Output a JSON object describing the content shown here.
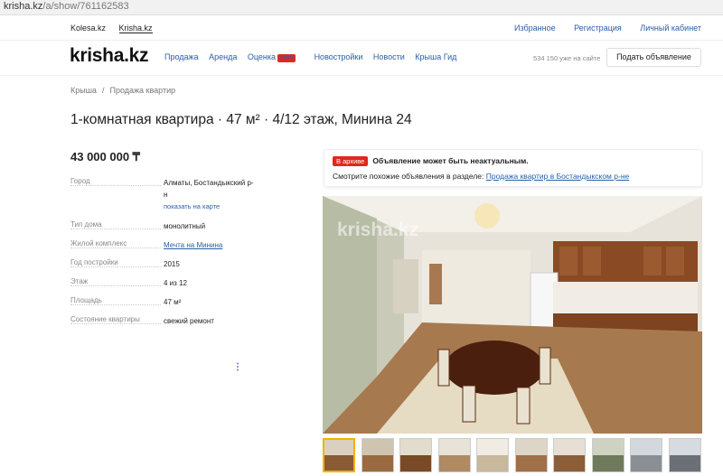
{
  "browser": {
    "url_host": "krisha.kz",
    "url_path": "/a/show/761162583"
  },
  "topbar": {
    "left_links": [
      "Kolesa.kz",
      "Krisha.kz"
    ],
    "right_links": [
      "Избранное",
      "Регистрация",
      "Личный кабинет"
    ]
  },
  "header": {
    "logo": "krisha.kz",
    "nav": {
      "sale": "Продажа",
      "rent": "Аренда",
      "valuation": "Оценка",
      "new_badge": "New",
      "new_buildings": "Новостройки",
      "news": "Новости",
      "guide": "Крыша Гид"
    },
    "online_count": "534 150 уже на сайте",
    "post_button": "Подать объявление"
  },
  "breadcrumb": {
    "root": "Крыша",
    "separator": "/",
    "current": "Продажа квартир"
  },
  "listing": {
    "title": "1-комнатная квартира · 47 м² · 4/12 этаж, Минина 24",
    "price": "43 000 000 ₸",
    "params": [
      {
        "label": "Город",
        "value": "Алматы, Бостандыкский р-н",
        "link": "показать на карте"
      },
      {
        "label": "Тип дома",
        "value": "монолитный"
      },
      {
        "label": "Жилой комплекс",
        "value": "Мечта на Минина"
      },
      {
        "label": "Год постройки",
        "value": "2015"
      },
      {
        "label": "Этаж",
        "value": "4 из 12"
      },
      {
        "label": "Площадь",
        "value": "47 м²"
      },
      {
        "label": "Состояние квартиры",
        "value": "свежий ремонт"
      }
    ],
    "more_icon": "more-vertical-icon"
  },
  "archive_notice": {
    "tag": "В архиве",
    "message": "Объявление может быть неактуальным.",
    "similar_text": "Смотрите похожие объявления в разделе:",
    "similar_link": "Продажа квартир в Бостандыкском р-не"
  },
  "gallery": {
    "watermark": "krisha.kz",
    "thumbnail_count": 10,
    "selected_index": 0
  },
  "colors": {
    "link": "#2a5fa5",
    "accent_red": "#e0281e",
    "selected_thumb": "#f0b400"
  }
}
